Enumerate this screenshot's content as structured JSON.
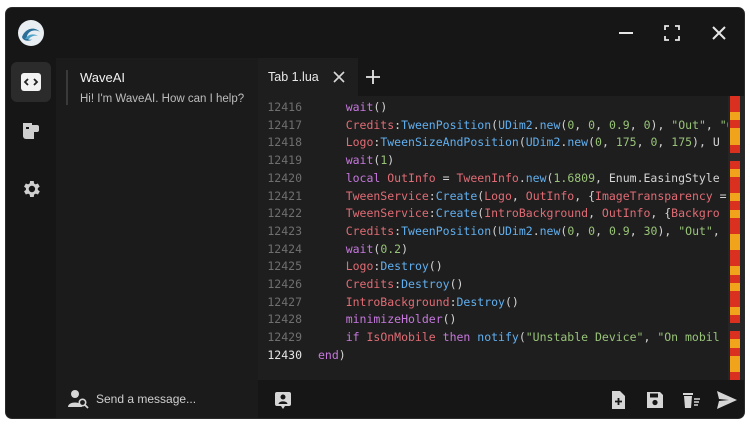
{
  "app": {
    "name": "WaveAI"
  },
  "chat": {
    "assistant_name": "WaveAI",
    "greeting": "Hi! I'm WaveAI. How can I help?",
    "input_placeholder": "Send a message..."
  },
  "editor": {
    "tabs": [
      {
        "label": "Tab 1.lua",
        "active": true
      }
    ],
    "current_line": "12430",
    "lines": [
      {
        "n": "12416",
        "tokens": [
          [
            "fn",
            "    wait"
          ],
          [
            "p",
            "()"
          ]
        ]
      },
      {
        "n": "12417",
        "tokens": [
          [
            "obj",
            "    Credits"
          ],
          [
            "p",
            ":"
          ],
          [
            "meth",
            "TweenPosition"
          ],
          [
            "p",
            "("
          ],
          [
            "meth",
            "UDim2"
          ],
          [
            "p",
            "."
          ],
          [
            "meth",
            "new"
          ],
          [
            "p",
            "("
          ],
          [
            "num",
            "0"
          ],
          [
            "p",
            ", "
          ],
          [
            "num",
            "0"
          ],
          [
            "p",
            ", "
          ],
          [
            "num",
            "0.9"
          ],
          [
            "p",
            ", "
          ],
          [
            "num",
            "0"
          ],
          [
            "p",
            "), "
          ],
          [
            "str",
            "\"Out\""
          ],
          [
            "p",
            ", "
          ],
          [
            "str",
            "\"Q"
          ]
        ]
      },
      {
        "n": "12418",
        "tokens": [
          [
            "obj",
            "    Logo"
          ],
          [
            "p",
            ":"
          ],
          [
            "meth",
            "TweenSizeAndPosition"
          ],
          [
            "p",
            "("
          ],
          [
            "meth",
            "UDim2"
          ],
          [
            "p",
            "."
          ],
          [
            "meth",
            "new"
          ],
          [
            "p",
            "("
          ],
          [
            "num",
            "0"
          ],
          [
            "p",
            ", "
          ],
          [
            "num",
            "175"
          ],
          [
            "p",
            ", "
          ],
          [
            "num",
            "0"
          ],
          [
            "p",
            ", "
          ],
          [
            "num",
            "175"
          ],
          [
            "p",
            "), U"
          ]
        ]
      },
      {
        "n": "12419",
        "tokens": [
          [
            "fn",
            "    wait"
          ],
          [
            "p",
            "("
          ],
          [
            "num",
            "1"
          ],
          [
            "p",
            ")"
          ]
        ]
      },
      {
        "n": "12420",
        "tokens": [
          [
            "kw",
            "    local "
          ],
          [
            "obj",
            "OutInfo"
          ],
          [
            "p",
            " = "
          ],
          [
            "obj",
            "TweenInfo"
          ],
          [
            "p",
            "."
          ],
          [
            "meth",
            "new"
          ],
          [
            "p",
            "("
          ],
          [
            "num",
            "1.6809"
          ],
          [
            "p",
            ", "
          ],
          [
            "enum",
            "Enum.EasingStyle"
          ]
        ]
      },
      {
        "n": "12421",
        "tokens": [
          [
            "obj",
            "    TweenService"
          ],
          [
            "p",
            ":"
          ],
          [
            "meth",
            "Create"
          ],
          [
            "p",
            "("
          ],
          [
            "obj",
            "Logo"
          ],
          [
            "p",
            ", "
          ],
          [
            "obj",
            "OutInfo"
          ],
          [
            "p",
            ", {"
          ],
          [
            "obj",
            "ImageTransparency"
          ],
          [
            "p",
            " ="
          ]
        ]
      },
      {
        "n": "12422",
        "tokens": [
          [
            "obj",
            "    TweenService"
          ],
          [
            "p",
            ":"
          ],
          [
            "meth",
            "Create"
          ],
          [
            "p",
            "("
          ],
          [
            "obj",
            "IntroBackground"
          ],
          [
            "p",
            ", "
          ],
          [
            "obj",
            "OutInfo"
          ],
          [
            "p",
            ", {"
          ],
          [
            "obj",
            "Backgro"
          ]
        ]
      },
      {
        "n": "12423",
        "tokens": [
          [
            "obj",
            "    Credits"
          ],
          [
            "p",
            ":"
          ],
          [
            "meth",
            "TweenPosition"
          ],
          [
            "p",
            "("
          ],
          [
            "meth",
            "UDim2"
          ],
          [
            "p",
            "."
          ],
          [
            "meth",
            "new"
          ],
          [
            "p",
            "("
          ],
          [
            "num",
            "0"
          ],
          [
            "p",
            ", "
          ],
          [
            "num",
            "0"
          ],
          [
            "p",
            ", "
          ],
          [
            "num",
            "0.9"
          ],
          [
            "p",
            ", "
          ],
          [
            "num",
            "30"
          ],
          [
            "p",
            "), "
          ],
          [
            "str",
            "\"Out\""
          ],
          [
            "p",
            ", \""
          ]
        ]
      },
      {
        "n": "12424",
        "tokens": [
          [
            "fn",
            "    wait"
          ],
          [
            "p",
            "("
          ],
          [
            "num",
            "0.2"
          ],
          [
            "p",
            ")"
          ]
        ]
      },
      {
        "n": "12425",
        "tokens": [
          [
            "obj",
            "    Logo"
          ],
          [
            "p",
            ":"
          ],
          [
            "meth",
            "Destroy"
          ],
          [
            "p",
            "()"
          ]
        ]
      },
      {
        "n": "12426",
        "tokens": [
          [
            "obj",
            "    Credits"
          ],
          [
            "p",
            ":"
          ],
          [
            "meth",
            "Destroy"
          ],
          [
            "p",
            "()"
          ]
        ]
      },
      {
        "n": "12427",
        "tokens": [
          [
            "obj",
            "    IntroBackground"
          ],
          [
            "p",
            ":"
          ],
          [
            "meth",
            "Destroy"
          ],
          [
            "p",
            "()"
          ]
        ]
      },
      {
        "n": "12428",
        "tokens": [
          [
            "fn",
            "    minimizeHolder"
          ],
          [
            "p",
            "()"
          ]
        ]
      },
      {
        "n": "12429",
        "tokens": [
          [
            "kw",
            "    if "
          ],
          [
            "obj",
            "IsOnMobile"
          ],
          [
            "kw",
            " then "
          ],
          [
            "meth",
            "notify"
          ],
          [
            "p",
            "("
          ],
          [
            "str",
            "\"Unstable Device\""
          ],
          [
            "p",
            ", "
          ],
          [
            "str",
            "\"On mobil"
          ]
        ]
      },
      {
        "n": "12430",
        "tokens": [
          [
            "kw",
            "end"
          ],
          [
            "p",
            ")"
          ]
        ]
      }
    ]
  },
  "minimap": {
    "colors": [
      "#d9301f",
      "#f0a31b",
      "#2b2b2b"
    ]
  },
  "icons": {
    "logo": "wave-logo-icon",
    "minimize": "minimize-icon",
    "maximize": "maximize-icon",
    "close": "close-icon",
    "code": "code-editor-icon",
    "scripts": "script-hub-icon",
    "settings": "gear-icon",
    "chat_user": "user-search-icon",
    "tab_close": "close-icon",
    "tab_add": "plus-icon",
    "prompt": "prompt-icon",
    "new_file": "new-file-icon",
    "save": "save-icon",
    "clear": "clear-icon",
    "execute": "send-icon"
  }
}
